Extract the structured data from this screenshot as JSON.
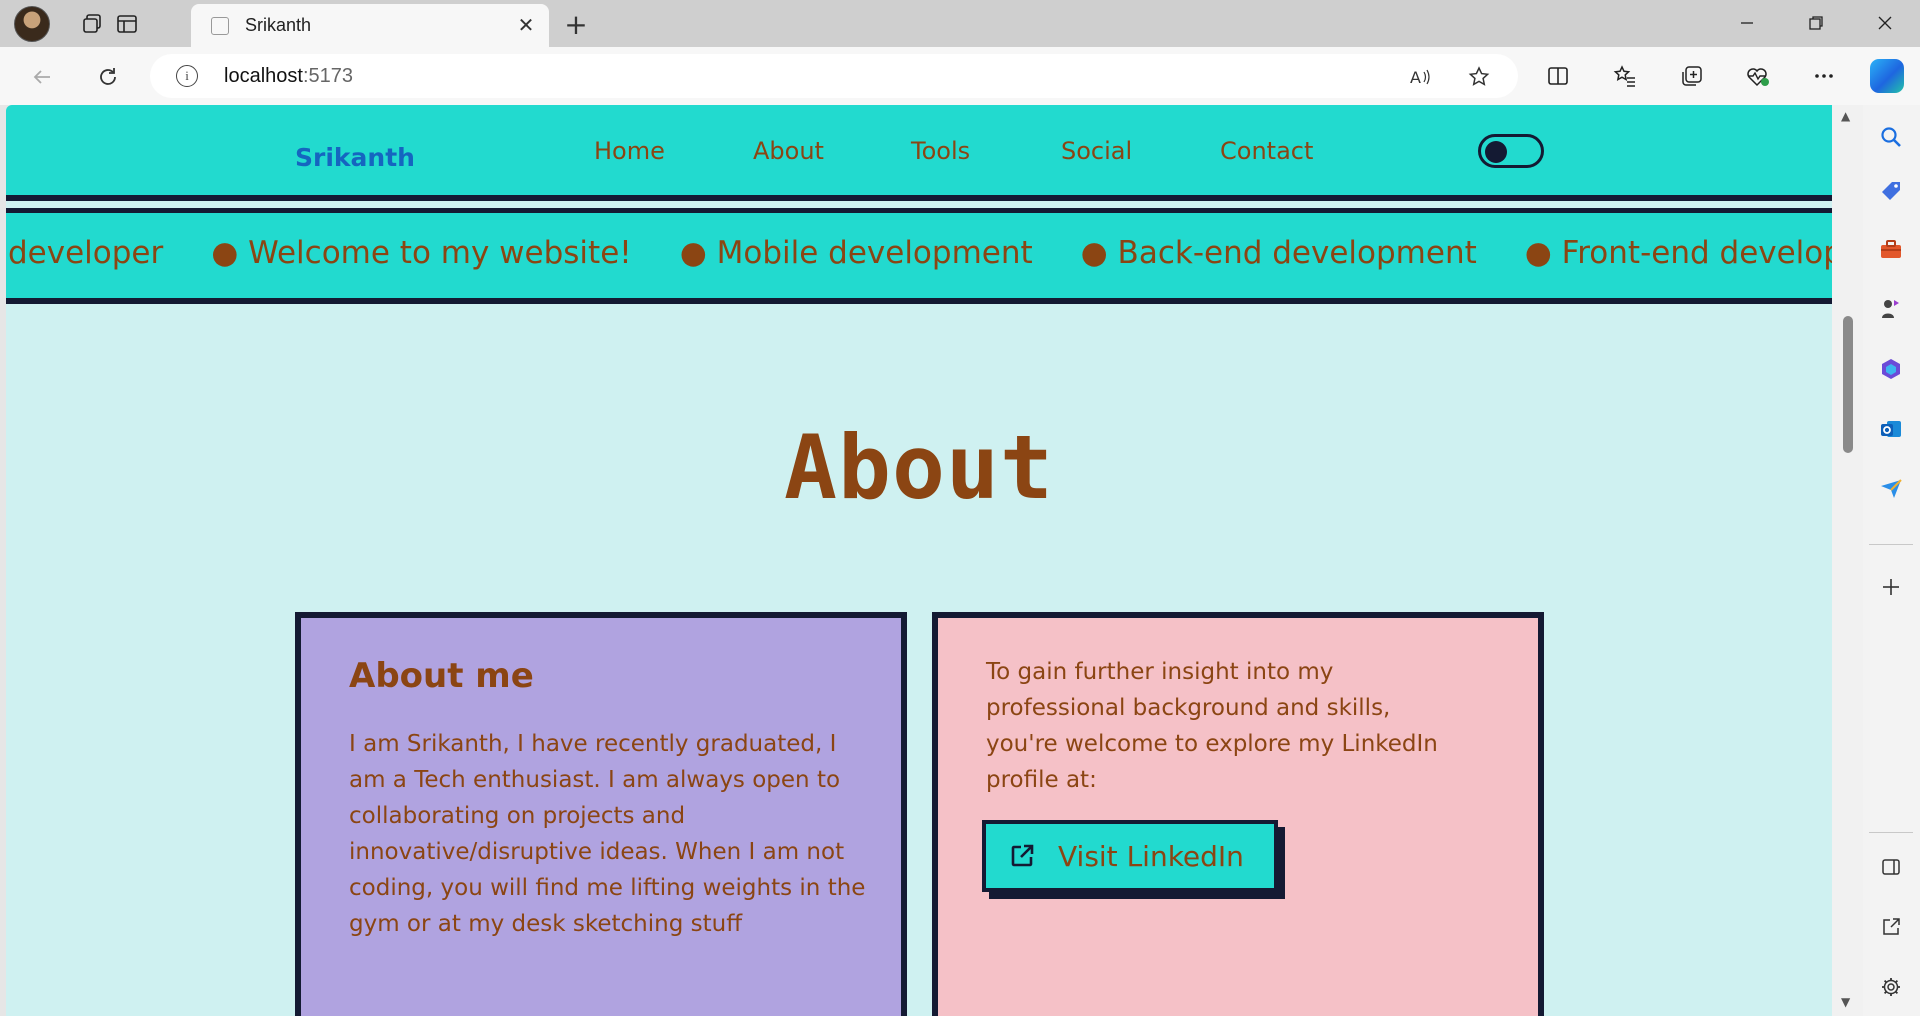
{
  "browser": {
    "tab_title": "Srikanth",
    "url_host": "localhost",
    "url_port": ":5173",
    "new_tab_label": "+",
    "close_glyph": "✕"
  },
  "site": {
    "brand": "Srikanth",
    "nav": {
      "home": "Home",
      "about": "About",
      "tools": "Tools",
      "social": "Social",
      "contact": "Contact"
    },
    "marquee": [
      "developer",
      "● Welcome to my website!",
      "● Mobile development",
      "● Back-end development",
      "● Front-end development"
    ],
    "section_title": "About",
    "about_card": {
      "heading": "About me",
      "body": "I am Srikanth, I have recently graduated, I am a Tech enthusiast. I am always open to collaborating on projects and innovative/disruptive ideas. When I am not coding, you will find me lifting weights in the gym or at my desk sketching stuff"
    },
    "linkedin_card": {
      "body": "To gain further insight into my professional background and skills, you're welcome to explore my LinkedIn profile at:",
      "button_label": "Visit LinkedIn"
    }
  },
  "colors": {
    "accent": "#22dacf",
    "page_bg": "#cff1f1",
    "text_brown": "#8b4513",
    "brand_blue": "#1565c0",
    "border_dark": "#141a33",
    "card_purple": "#b0a3e0",
    "card_pink": "#f5c1c7"
  }
}
